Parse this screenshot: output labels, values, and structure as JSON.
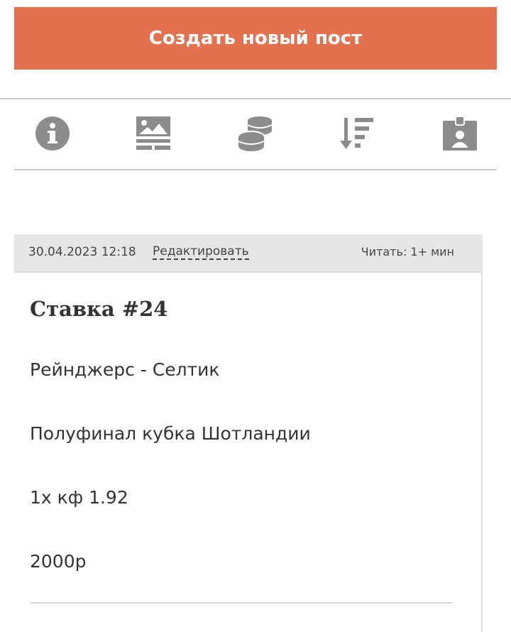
{
  "header": {
    "create_post_label": "Создать новый пост"
  },
  "toolbar": {
    "icons": [
      "info-icon",
      "image-gallery-icon",
      "coins-icon",
      "sort-descending-icon",
      "badge-icon"
    ],
    "icon_color": "#8c8c8c"
  },
  "post": {
    "date": "30.04.2023 12:18",
    "edit_label": "Редактировать",
    "read_time": "Читать: 1+ мин",
    "title": "Ставка #24",
    "lines": [
      "Рейнджерс - Селтик",
      "Полуфинал кубка Шотландии",
      "1х кф 1.92",
      "2000р"
    ]
  },
  "colors": {
    "accent": "#e4714d",
    "header_bg": "#e6e6e6",
    "divider": "#c9c9c9"
  }
}
